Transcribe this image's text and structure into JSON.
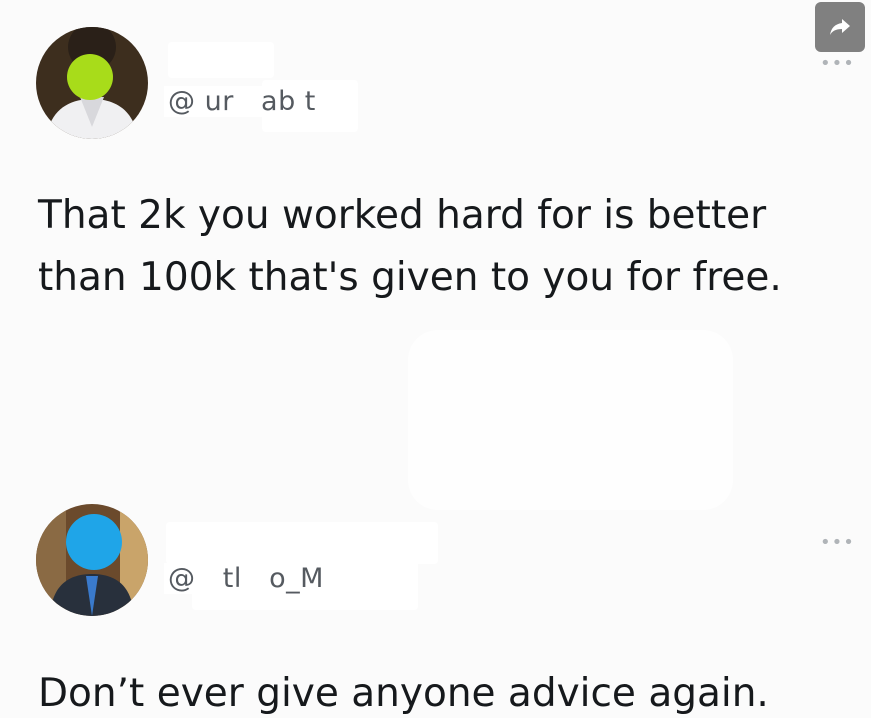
{
  "share": {
    "icon": "share-arrow-icon"
  },
  "tweets": [
    {
      "avatar_icon": "avatar-icon",
      "handle": "@ ur   ab t",
      "more_icon": "more-options-icon",
      "more_label": "•••",
      "text": "That 2k you worked hard for is better\nthan 100k that's given to you for free."
    },
    {
      "avatar_icon": "avatar-icon",
      "handle": "@   tl   o_M",
      "more_icon": "more-options-icon",
      "more_label": "•••",
      "text": "Don’t ever give anyone advice again."
    }
  ]
}
